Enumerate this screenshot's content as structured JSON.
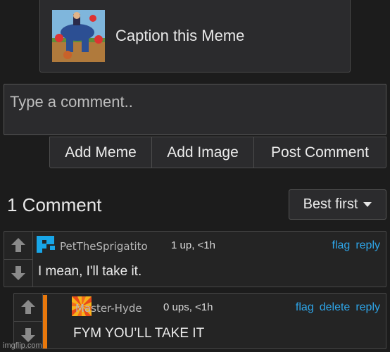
{
  "caption": {
    "label": "Caption this Meme"
  },
  "comment_input": {
    "placeholder": "Type a comment.."
  },
  "buttons": {
    "add_meme": "Add Meme",
    "add_image": "Add Image",
    "post_comment": "Post Comment"
  },
  "comments_header": {
    "count_label": "1 Comment",
    "sort_label": "Best first"
  },
  "comments": [
    {
      "username": "PetTheSprigatito",
      "meta": "1 up, <1h",
      "text": "I mean, I'll take it.",
      "actions": [
        "flag",
        "reply"
      ]
    },
    {
      "username": "Master-Hyde",
      "meta": "0 ups, <1h",
      "text": "FYM YOU’LL TAKE IT",
      "actions": [
        "flag",
        "delete",
        "reply"
      ]
    }
  ],
  "watermark": "imgflip.com",
  "colors": {
    "link": "#2ea5e8",
    "accent_bar": "#e8780c",
    "background": "#1c1c1c"
  }
}
